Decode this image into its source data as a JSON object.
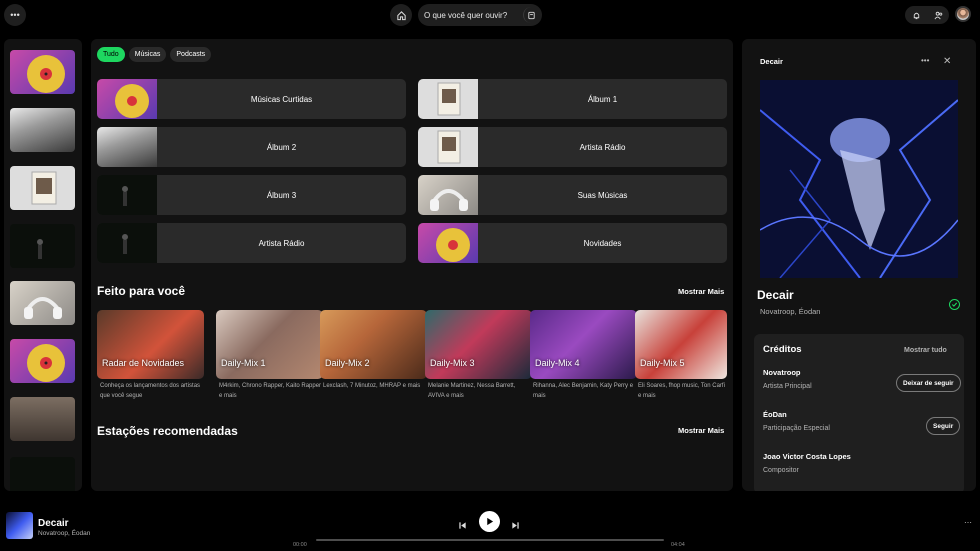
{
  "topbar": {
    "menu_icon": "more-horizontal-icon",
    "home_icon": "home-icon",
    "search": {
      "placeholder": "O que você quer ouvir?",
      "browse_icon": "browse-icon"
    },
    "notifications_icon": "bell-icon",
    "friends_icon": "friends-icon"
  },
  "filters": [
    {
      "label": "Tudo",
      "active": true
    },
    {
      "label": "Músicas",
      "active": false
    },
    {
      "label": "Podcasts",
      "active": false
    }
  ],
  "shortcuts": [
    {
      "label": "Músicas Curtidas",
      "art": "vinyl"
    },
    {
      "label": "Álbum 1",
      "art": "record"
    },
    {
      "label": "Álbum 2",
      "art": "studio"
    },
    {
      "label": "Artista Rádio",
      "art": "record"
    },
    {
      "label": "Álbum 3",
      "art": "dark"
    },
    {
      "label": "Suas Músicas",
      "art": "headphones"
    },
    {
      "label": "Artista Rádio",
      "art": "dark"
    },
    {
      "label": "Novidades",
      "art": "vinyl"
    }
  ],
  "made_for_you": {
    "title": "Feito para você",
    "show_more": "Mostrar Mais",
    "items": [
      {
        "title": "Radar de Novidades",
        "desc": "Conheça os lançamentos dos artistas que você segue"
      },
      {
        "title": "Daily-Mix 1",
        "desc": "M4rkim, Chrono Rapper, Kaito Rapper e mais"
      },
      {
        "title": "Daily-Mix 2",
        "desc": "Lexclash, 7 Minutoz, MHRAP e mais"
      },
      {
        "title": "Daily-Mix 3",
        "desc": "Melanie Martinez, Nessa Barrett, AVIVA e mais"
      },
      {
        "title": "Daily-Mix 4",
        "desc": "Rihanna, Alec Benjamin, Katy Perry e mais"
      },
      {
        "title": "Daily-Mix 5",
        "desc": "Eli Soares, fhop music, Ton Carfi e mais"
      }
    ]
  },
  "stations": {
    "title": "Estações recomendadas",
    "show_more": "Mostrar Mais"
  },
  "now_playing_panel": {
    "header": "Decair",
    "track_title": "Decair",
    "artists": "Novatroop, Éodan",
    "credits_title": "Créditos",
    "credits_show_all": "Mostrar tudo",
    "credits": [
      {
        "name": "Novatroop",
        "role": "Artista Principal",
        "button": "Deixar de seguir"
      },
      {
        "name": "ÉoDan",
        "role": "Participação Especial",
        "button": "Seguir"
      },
      {
        "name": "Joao Victor Costa Lopes",
        "role": "Compositor",
        "button": ""
      }
    ]
  },
  "player": {
    "title": "Decair",
    "artists": "Novatroop, Éodan",
    "elapsed": "00:00",
    "duration": "04:04",
    "progress": 0
  },
  "colors": {
    "accent": "#1ed760",
    "bg": "#000000",
    "panel": "#121212",
    "card": "#2a2a2a"
  }
}
